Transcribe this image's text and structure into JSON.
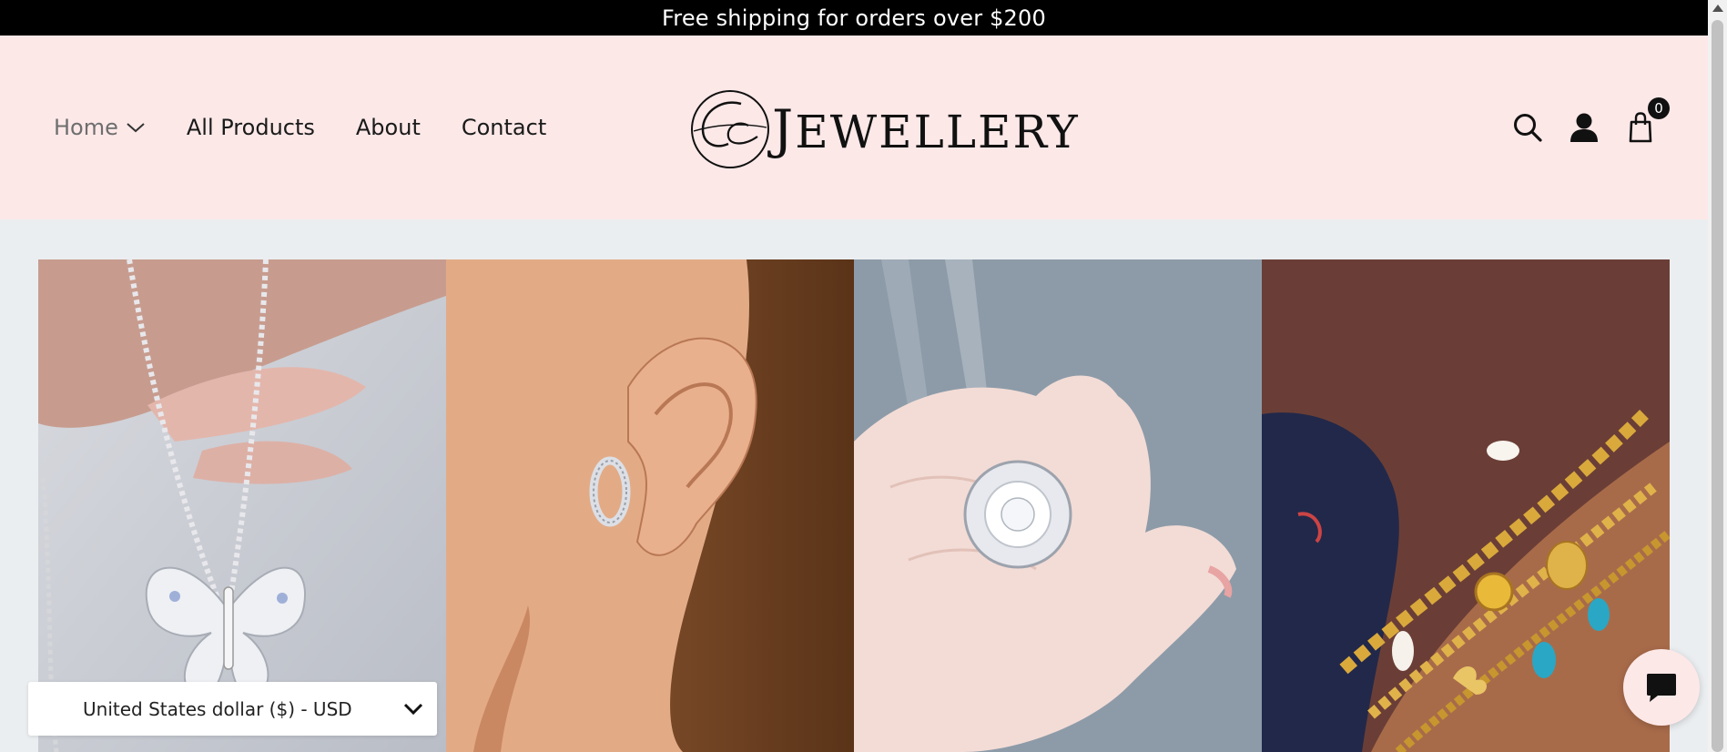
{
  "announcement": {
    "text": "Free shipping for orders over $200"
  },
  "nav": {
    "items": [
      {
        "label": "Home",
        "has_dropdown": true
      },
      {
        "label": "All Products"
      },
      {
        "label": "About"
      },
      {
        "label": "Contact"
      }
    ]
  },
  "logo": {
    "text_initial": "J",
    "text_rest": "EWELLERY"
  },
  "header_icons": {
    "search": "search-icon",
    "account": "account-icon",
    "cart": "cart-icon",
    "cart_count": "0"
  },
  "gallery": {
    "tiles": [
      {
        "subject": "butterfly-necklace"
      },
      {
        "subject": "hoop-earring"
      },
      {
        "subject": "flower-diamond-ring"
      },
      {
        "subject": "gold-charm-bracelets"
      }
    ]
  },
  "currency": {
    "selected": "United States dollar ($) - USD"
  },
  "chat": {
    "icon": "chat-icon"
  },
  "colors": {
    "announcement_bg": "#000000",
    "header_bg": "#fde8e8",
    "page_bg": "#ebeef0",
    "text": "#1a1a1a"
  }
}
